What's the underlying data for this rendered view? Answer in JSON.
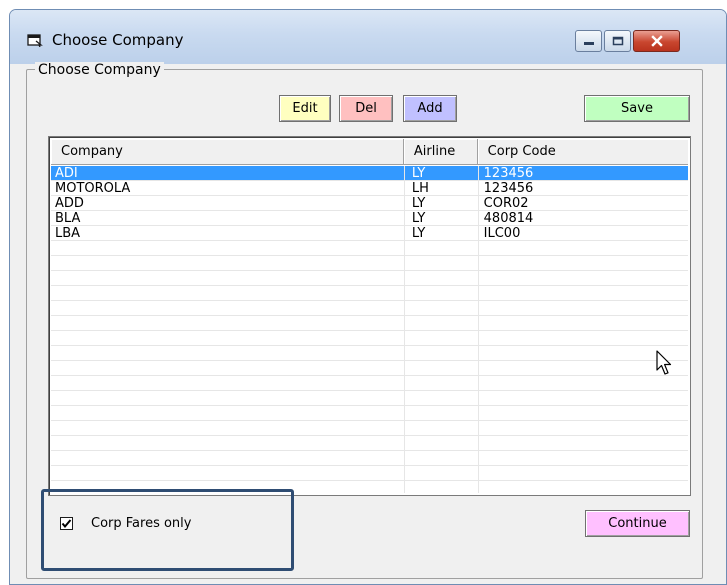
{
  "window": {
    "title": "Choose Company"
  },
  "group": {
    "label": "Choose Company"
  },
  "toolbar": {
    "edit_label": "Edit",
    "del_label": "Del",
    "add_label": "Add",
    "save_label": "Save"
  },
  "table": {
    "columns": [
      "Company",
      "Airline",
      "Corp Code"
    ],
    "rows": [
      {
        "company": "ADI",
        "airline": "LY",
        "corp_code": "123456",
        "selected": true
      },
      {
        "company": "MOTOROLA",
        "airline": "LH",
        "corp_code": "123456",
        "selected": false
      },
      {
        "company": "ADD",
        "airline": "LY",
        "corp_code": "COR02",
        "selected": false
      },
      {
        "company": "BLA",
        "airline": "LY",
        "corp_code": "480814",
        "selected": false
      },
      {
        "company": "LBA",
        "airline": "LY",
        "corp_code": "ILC00",
        "selected": false
      }
    ]
  },
  "options": {
    "corp_fares_only_label": "Corp Fares only",
    "corp_fares_only_checked": true
  },
  "footer": {
    "continue_label": "Continue"
  },
  "icons": {
    "title": "window-app-icon",
    "minimize": "minimize-icon",
    "maximize": "maximize-icon",
    "close": "close-icon",
    "check": "checkmark-icon",
    "cursor": "mouse-pointer-icon"
  },
  "colors": {
    "selection": "#3399ff",
    "edit_button": "#ffffc0",
    "del_button": "#ffc0c0",
    "add_button": "#c0c0ff",
    "save_button": "#c0ffc0",
    "continue_button": "#ffc0ff",
    "highlight_outline": "#2f4d73"
  }
}
